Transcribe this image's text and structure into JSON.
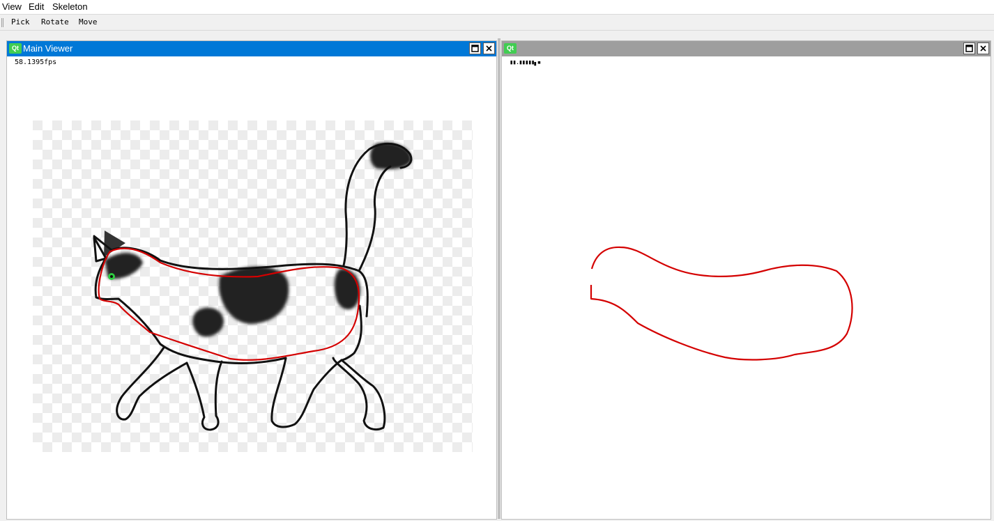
{
  "menubar": {
    "items": [
      "View",
      "Edit",
      "Skeleton"
    ]
  },
  "toolbar": {
    "buttons": [
      "Pick",
      "Rotate",
      "Move"
    ]
  },
  "main_viewer": {
    "title": "Main Viewer",
    "fps": "58.1395fps",
    "title_color": "#0078d7"
  },
  "second_viewer": {
    "title": "",
    "fps_obscured": "▮▮.▮▮▮▮▮▖▪",
    "title_color": "#9e9e9e"
  },
  "icons": {
    "app": "qt-logo-icon",
    "maximize": "maximize-icon",
    "close": "close-icon"
  },
  "colors": {
    "outline": "#d40000",
    "marker": "#2ecc40",
    "cat_line": "#111111"
  }
}
